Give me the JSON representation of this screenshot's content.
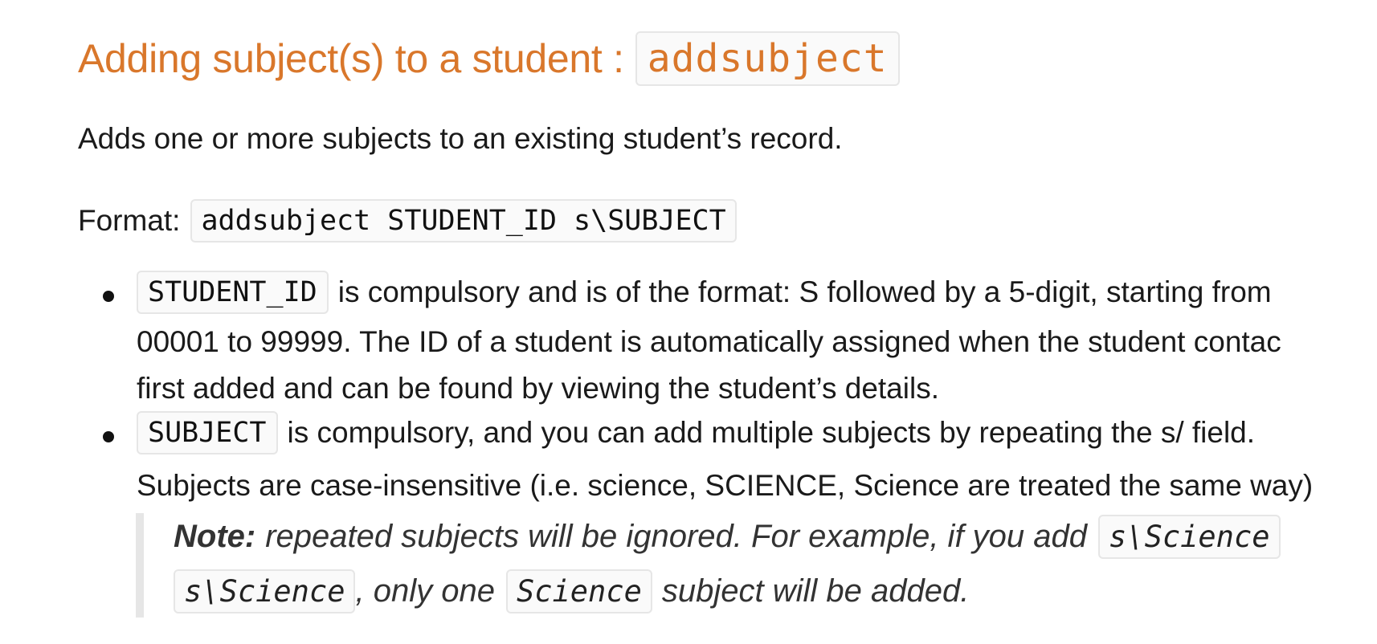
{
  "heading": {
    "text": "Adding subject(s) to a student :",
    "command": "addsubject"
  },
  "description": "Adds one or more subjects to an existing student’s record.",
  "format": {
    "label": "Format:",
    "syntax": "addsubject STUDENT_ID s\\SUBJECT"
  },
  "bullets": [
    {
      "code": "STUDENT_ID",
      "line1": "is compulsory and is of the format: S followed by a 5-digit, starting from",
      "line2": "00001 to 99999. The ID of a student is automatically assigned when the student contac",
      "line3": "first added and can be found by viewing the student’s details."
    },
    {
      "code": "SUBJECT",
      "line1": "is compulsory, and you can add multiple subjects by repeating the s/ field.",
      "line2": "Subjects are case-insensitive (i.e. science, SCIENCE, Science are treated the same way)"
    }
  ],
  "note": {
    "label": "Note:",
    "text1": "repeated subjects will be ignored. For example, if you add",
    "code1": "s\\Science",
    "code2": "s\\Science",
    "text2": ", only one",
    "code3": "Science",
    "text3": "subject will be added."
  }
}
